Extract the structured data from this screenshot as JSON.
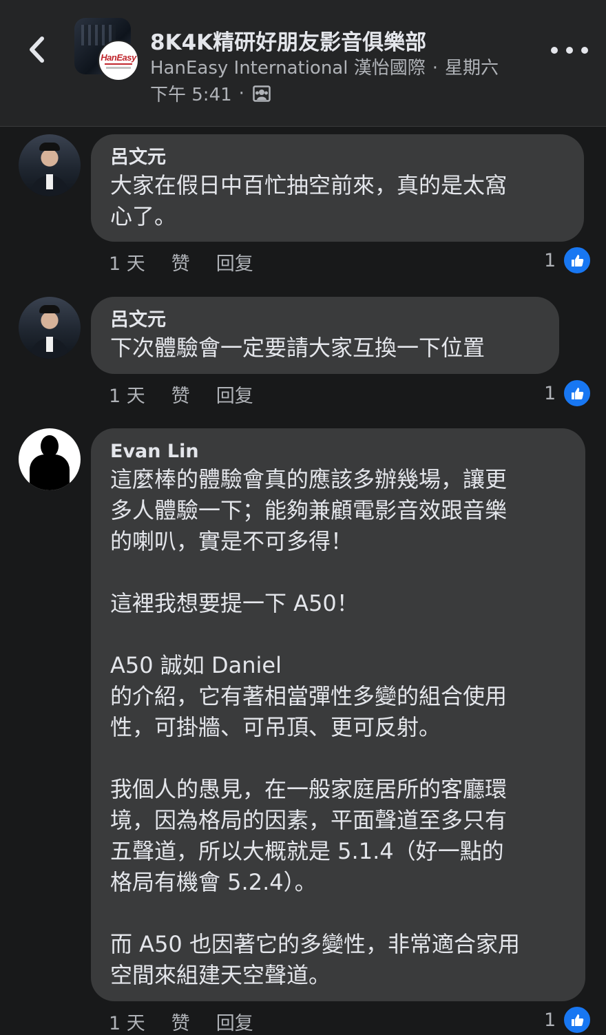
{
  "header": {
    "back_icon": "chevron-left-icon",
    "group_name": "8K4K精研好朋友影音俱樂部",
    "page_name": "HanEasy International 漢怡國際",
    "day": "星期六",
    "time": "下午 5:41",
    "separator": "·",
    "privacy_icon": "group-privacy-icon",
    "page_logo_text": "HanEasy",
    "more_icon": "more-dots-icon"
  },
  "comments": [
    {
      "author": "呂文元",
      "text": "大家在假日中百忙抽空前來，真的是太窩\n心了。",
      "time": "1 天",
      "like_label": "赞",
      "reply_label": "回复",
      "like_count": "1"
    },
    {
      "author": "呂文元",
      "text": "下次體驗會一定要請大家互換一下位置",
      "time": "1 天",
      "like_label": "赞",
      "reply_label": "回复",
      "like_count": "1"
    },
    {
      "author": "Evan Lin",
      "text": "這麼棒的體驗會真的應該多辦幾場，讓更\n多人體驗一下；能夠兼顧電影音效跟音樂\n的喇叭，實是不可多得！\n\n這裡我想要提一下 A50！\n\nA50 誠如 Daniel\n的介紹，它有著相當彈性多變的組合使用\n性，可掛牆、可吊頂、更可反射。\n\n我個人的愚見，在一般家庭居所的客廳環\n境，因為格局的因素，平面聲道至多只有\n五聲道，所以大概就是 5.1.4（好一點的\n格局有機會 5.2.4）。\n\n而 A50 也因著它的多變性，非常適合家用\n空間來組建天空聲道。",
      "time": "1 天",
      "like_label": "赞",
      "reply_label": "回复",
      "like_count": "1"
    }
  ],
  "colors": {
    "background": "#18191a",
    "bubble": "#3a3b3c",
    "like_blue": "#1877f2"
  }
}
